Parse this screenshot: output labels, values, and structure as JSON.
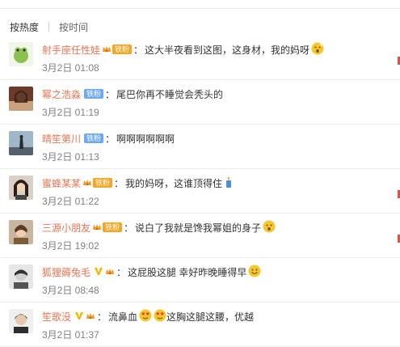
{
  "sort": {
    "hot": "按热度",
    "time": "按时间"
  },
  "comments": [
    {
      "user": "射手座任性娃",
      "vip_icon": "crown-level-icon",
      "fan_label": "铁粉",
      "fan_color": "gold",
      "text": "这大半夜看到这图，这身材，我的妈呀",
      "emoji": "shocked-emoji-icon",
      "time": "3月2日 01:08"
    },
    {
      "user": "幂之浩淼",
      "fan_label": "铁粉",
      "fan_color": "blue",
      "text": "尾巴你再不睡觉会秃头的",
      "time": "3月2日 01:19"
    },
    {
      "user": "晴笙第川",
      "fan_label": "铁粉",
      "fan_color": "blue",
      "text": "啊啊啊啊啊啊",
      "time": "3月2日 01:13"
    },
    {
      "user": "蜜蜂某某",
      "vip_icon": "crown-level-icon",
      "fan_label": "铁粉",
      "fan_color": "gold",
      "text": "我的妈呀，这谁顶得住",
      "emoji": "candle-emoji-icon",
      "time": "3月2日 01:22"
    },
    {
      "user": "三源小朋友",
      "vip_icon": "crown-level-icon",
      "fan_label": "铁粉",
      "fan_color": "gold",
      "text": "说白了我就是馋我幂姐的身子",
      "emoji": "shocked-emoji-icon",
      "time": "3月2日 19:02"
    },
    {
      "user": "狐狸薅兔毛",
      "verified": "yellow-v-icon",
      "vip_icon": "crown-level-icon",
      "text": "这屁股这腿 幸好昨晚睡得早",
      "emoji": "smile-emoji-icon",
      "time": "3月2日 08:48"
    },
    {
      "user": "笙歌没",
      "verified": "yellow-v-icon",
      "vip_icon": "crown-level-icon",
      "text": "流鼻血",
      "emoji_pair": "heart-eyes-emoji-icon",
      "text2": "这胸这腿这腰，优越",
      "time": "3月2日 01:37"
    }
  ],
  "colors": {
    "username": "#eb7350",
    "gold_badge": "#f6a623",
    "blue_badge": "#6ea9f0",
    "timestamp": "#808080"
  }
}
